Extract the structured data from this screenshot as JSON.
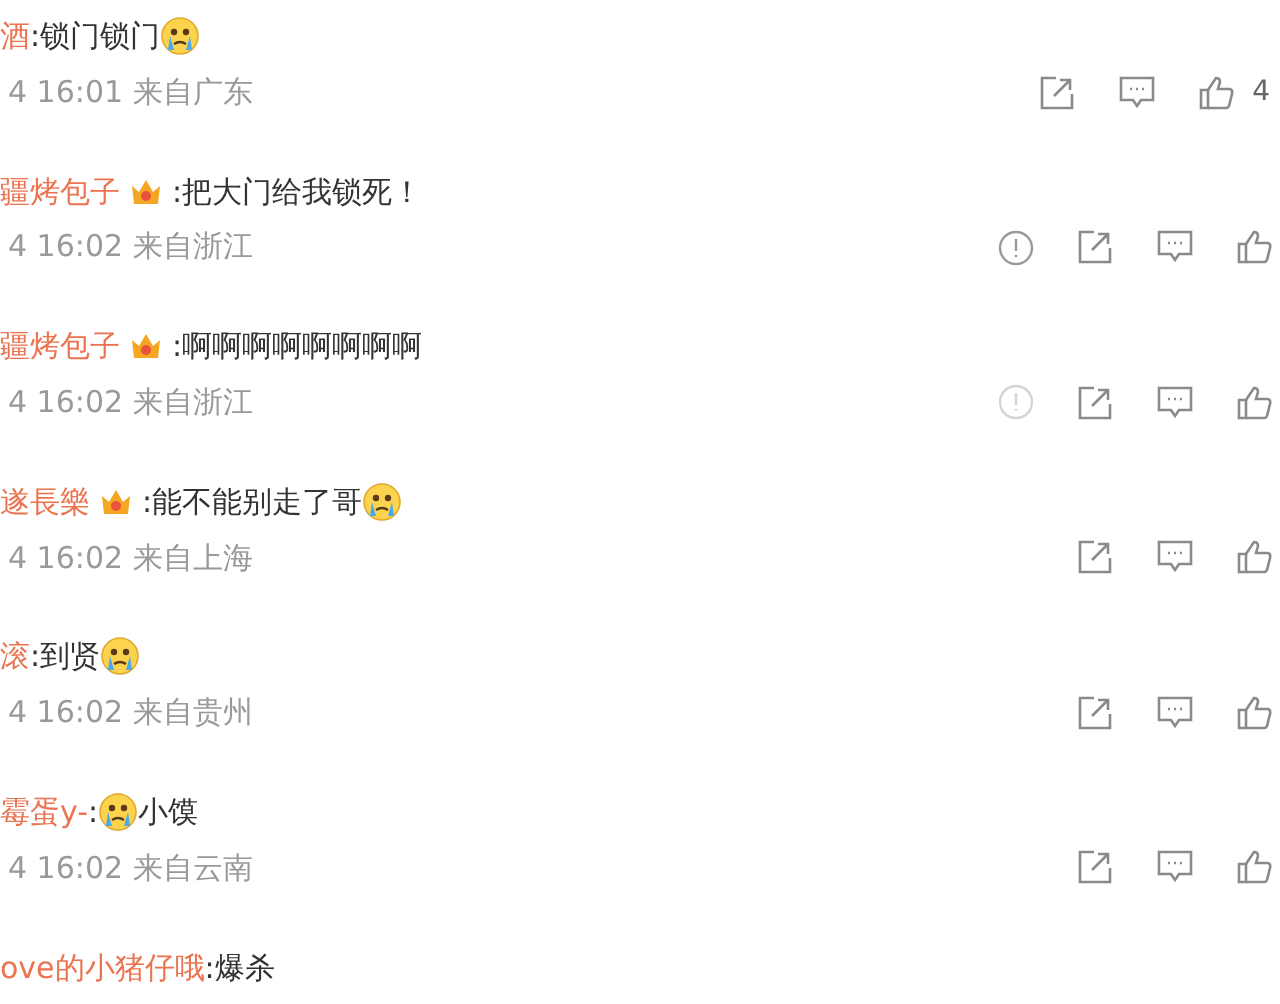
{
  "comments": [
    {
      "name": "酒",
      "badge": false,
      "content": [
        {
          "kind": "text",
          "text": ":锁门锁门"
        },
        {
          "kind": "emoji"
        }
      ],
      "meta": "4 16:01 来自广东",
      "likes": "4"
    },
    {
      "name": "疆烤包子",
      "badge": true,
      "content": [
        {
          "kind": "text",
          "text": ":把大门给我锁死！"
        }
      ],
      "meta": "4 16:02 来自浙江",
      "report": {
        "dimmed": false
      }
    },
    {
      "name": "疆烤包子",
      "badge": true,
      "content": [
        {
          "kind": "text",
          "text": ":啊啊啊啊啊啊啊啊"
        }
      ],
      "meta": "4 16:02 来自浙江",
      "report": {
        "dimmed": true
      }
    },
    {
      "name": "遂長樂",
      "badge": true,
      "content": [
        {
          "kind": "text",
          "text": ":能不能别走了哥"
        },
        {
          "kind": "emoji"
        }
      ],
      "meta": "4 16:02 来自上海"
    },
    {
      "name": "滚",
      "badge": false,
      "content": [
        {
          "kind": "text",
          "text": ":到贤"
        },
        {
          "kind": "emoji"
        }
      ],
      "meta": "4 16:02 来自贵州"
    },
    {
      "name": "霉蛋y-",
      "badge": false,
      "content": [
        {
          "kind": "text",
          "text": ":"
        },
        {
          "kind": "emoji"
        },
        {
          "kind": "text",
          "text": "小馍"
        }
      ],
      "meta": "4 16:02 来自云南"
    },
    {
      "name": "ove的小猪仔哦",
      "badge": false,
      "content": [
        {
          "kind": "text",
          "text": ":爆杀"
        }
      ]
    }
  ]
}
